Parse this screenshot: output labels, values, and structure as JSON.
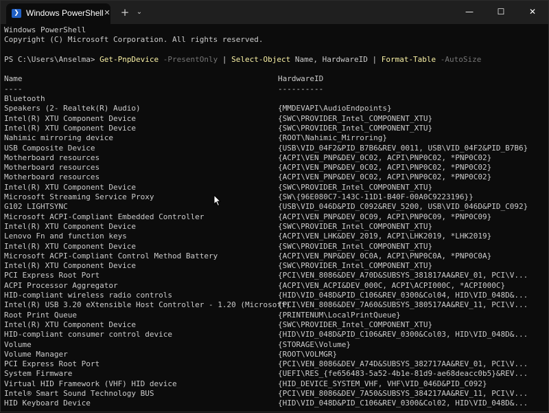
{
  "titlebar": {
    "tab_title": "Windows PowerShell",
    "tab_close": "✕",
    "new_tab": "+",
    "dropdown": "⌄",
    "minimize": "—",
    "maximize": "☐",
    "close": "✕"
  },
  "header": {
    "line1": "Windows PowerShell",
    "line2": "Copyright (C) Microsoft Corporation. All rights reserved."
  },
  "prompt": {
    "path": "PS C:\\Users\\Anselma> ",
    "cmd1": "Get-PnpDevice",
    "param1": " -PresentOnly",
    "pipe1": " | ",
    "cmd2": "Select-Object",
    "args2": " Name, HardwareID",
    "pipe2": " | ",
    "cmd3": "Format-Table",
    "param3": " -AutoSize"
  },
  "table": {
    "col_name": "Name",
    "col_hwid": "HardwareID",
    "sep_name": "----",
    "sep_hwid": "----------",
    "rows": [
      {
        "name": "Bluetooth",
        "hwid": ""
      },
      {
        "name": "Speakers (2- Realtek(R) Audio)",
        "hwid": "{MMDEVAPI\\AudioEndpoints}"
      },
      {
        "name": "Intel(R) XTU Component Device",
        "hwid": "{SWC\\PROVIDER_Intel_COMPONENT_XTU}"
      },
      {
        "name": "Intel(R) XTU Component Device",
        "hwid": "{SWC\\PROVIDER_Intel_COMPONENT_XTU}"
      },
      {
        "name": "Nahimic mirroring device",
        "hwid": "{ROOT\\Nahimic_Mirroring}"
      },
      {
        "name": "USB Composite Device",
        "hwid": "{USB\\VID_04F2&PID_B7B6&REV_0011, USB\\VID_04F2&PID_B7B6}"
      },
      {
        "name": "Motherboard resources",
        "hwid": "{ACPI\\VEN_PNP&DEV_0C02, ACPI\\PNP0C02, *PNP0C02}"
      },
      {
        "name": "Motherboard resources",
        "hwid": "{ACPI\\VEN_PNP&DEV_0C02, ACPI\\PNP0C02, *PNP0C02}"
      },
      {
        "name": "Motherboard resources",
        "hwid": "{ACPI\\VEN_PNP&DEV_0C02, ACPI\\PNP0C02, *PNP0C02}"
      },
      {
        "name": "Intel(R) XTU Component Device",
        "hwid": "{SWC\\PROVIDER_Intel_COMPONENT_XTU}"
      },
      {
        "name": "Microsoft Streaming Service Proxy",
        "hwid": "{SW\\{96E080C7-143C-11D1-B40F-00A0C9223196}}"
      },
      {
        "name": "G102 LIGHTSYNC",
        "hwid": "{USB\\VID_046D&PID_C092&REV_5200, USB\\VID_046D&PID_C092}"
      },
      {
        "name": "Microsoft ACPI-Compliant Embedded Controller",
        "hwid": "{ACPI\\VEN_PNP&DEV_0C09, ACPI\\PNP0C09, *PNP0C09}"
      },
      {
        "name": "Intel(R) XTU Component Device",
        "hwid": "{SWC\\PROVIDER_Intel_COMPONENT_XTU}"
      },
      {
        "name": "Lenovo Fn and function keys",
        "hwid": "{ACPI\\VEN_LHK&DEV_2019, ACPI\\LHK2019, *LHK2019}"
      },
      {
        "name": "Intel(R) XTU Component Device",
        "hwid": "{SWC\\PROVIDER_Intel_COMPONENT_XTU}"
      },
      {
        "name": "Microsoft ACPI-Compliant Control Method Battery",
        "hwid": "{ACPI\\VEN_PNP&DEV_0C0A, ACPI\\PNP0C0A, *PNP0C0A}"
      },
      {
        "name": "Intel(R) XTU Component Device",
        "hwid": "{SWC\\PROVIDER_Intel_COMPONENT_XTU}"
      },
      {
        "name": "PCI Express Root Port",
        "hwid": "{PCI\\VEN_8086&DEV_A70D&SUBSYS_381817AA&REV_01, PCI\\V..."
      },
      {
        "name": "ACPI Processor Aggregator",
        "hwid": "{ACPI\\VEN_ACPI&DEV_000C, ACPI\\ACPI000C, *ACPI000C}"
      },
      {
        "name": "HID-compliant wireless radio controls",
        "hwid": "{HID\\VID_048D&PID_C106&REV_0300&Col04, HID\\VID_048D&..."
      },
      {
        "name": "Intel(R) USB 3.20 eXtensible Host Controller - 1.20 (Microsoft)",
        "hwid": "{PCI\\VEN_8086&DEV_7A60&SUBSYS_380517AA&REV_11, PCI\\V..."
      },
      {
        "name": "Root Print Queue",
        "hwid": "{PRINTENUM\\LocalPrintQueue}"
      },
      {
        "name": "Intel(R) XTU Component Device",
        "hwid": "{SWC\\PROVIDER_Intel_COMPONENT_XTU}"
      },
      {
        "name": "HID-compliant consumer control device",
        "hwid": "{HID\\VID_048D&PID_C106&REV_0300&Col03, HID\\VID_048D&..."
      },
      {
        "name": "Volume",
        "hwid": "{STORAGE\\Volume}"
      },
      {
        "name": "Volume Manager",
        "hwid": "{ROOT\\VOLMGR}"
      },
      {
        "name": "PCI Express Root Port",
        "hwid": "{PCI\\VEN_8086&DEV_A74D&SUBSYS_382717AA&REV_01, PCI\\V..."
      },
      {
        "name": "System Firmware",
        "hwid": "{UEFI\\RES_{fe656483-5a52-4b1e-81d9-ae68deacc0b5}&REV..."
      },
      {
        "name": "Virtual HID Framework (VHF) HID device",
        "hwid": "{HID_DEVICE_SYSTEM_VHF, VHF\\VID_046D&PID_C092}"
      },
      {
        "name": "Intel® Smart Sound Technology BUS",
        "hwid": "{PCI\\VEN_8086&DEV_7A50&SUBSYS_384217AA&REV_11, PCI\\V..."
      },
      {
        "name": "HID Keyboard Device",
        "hwid": "{HID\\VID_048D&PID_C106&REV_0300&Col02, HID\\VID_048D&..."
      }
    ]
  },
  "colors": {
    "background": "#0c0c0c",
    "text": "#cccccc",
    "command": "#f9f1a5",
    "parameter": "#767676",
    "titlebar": "#1f1f1f"
  }
}
